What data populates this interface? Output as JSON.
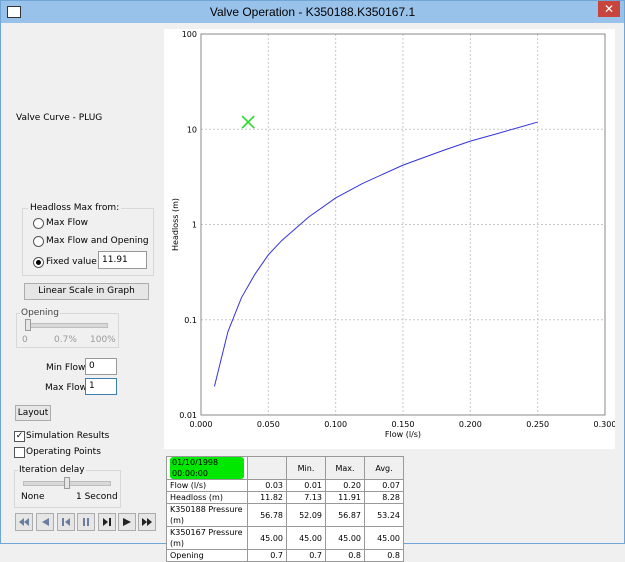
{
  "window": {
    "title": "Valve Operation - K350188.K350167.1",
    "close_symbol": "✕"
  },
  "left": {
    "valve_curve_label": "Valve Curve - PLUG",
    "headloss_group": {
      "title": "Headloss Max from:",
      "options": [
        "Max Flow",
        "Max Flow and Opening",
        "Fixed value"
      ],
      "selected": "Fixed value",
      "fixed_value": "11.91"
    },
    "linear_scale_button": "Linear Scale in Graph",
    "opening_group": {
      "title": "Opening",
      "ticks": [
        "0",
        "0.7%",
        "100%"
      ]
    },
    "min_flow": {
      "label": "Min Flow",
      "value": "0"
    },
    "max_flow": {
      "label": "Max Flow",
      "value": "1"
    },
    "layout_button": "Layout",
    "simulation_results": {
      "label": "Simulation Results",
      "checked": true
    },
    "operating_points": {
      "label": "Operating Points",
      "checked": false
    },
    "iteration_group": {
      "title": "Iteration delay",
      "left": "None",
      "right": "1 Second",
      "level": 0.5
    },
    "media_buttons": [
      "first-icon",
      "step-back-icon",
      "prev-icon",
      "pause-icon",
      "next-icon",
      "play-icon",
      "last-icon"
    ]
  },
  "chart_data": {
    "type": "line",
    "xlabel": "Flow (l/s)",
    "ylabel": "Headloss (m)",
    "xlim": [
      0,
      0.3
    ],
    "ylim": [
      0.01,
      100
    ],
    "yscale": "log",
    "x_ticks": [
      "0.000",
      "0.050",
      "0.100",
      "0.150",
      "0.200",
      "0.250",
      "0.300"
    ],
    "y_ticks": [
      "100",
      "10",
      "1",
      "0.1",
      "0.01"
    ],
    "grid": true,
    "series": [
      {
        "color": "#3333dd",
        "x": [
          0.01,
          0.02,
          0.03,
          0.04,
          0.05,
          0.06,
          0.08,
          0.1,
          0.12,
          0.15,
          0.18,
          0.2,
          0.22,
          0.25
        ],
        "y": [
          0.02,
          0.075,
          0.17,
          0.3,
          0.48,
          0.68,
          1.2,
          1.9,
          2.7,
          4.2,
          6.0,
          7.5,
          9.0,
          11.9
        ]
      }
    ],
    "marker": {
      "x": 0.035,
      "y": 11.91,
      "color": "#22dd22",
      "shape": "x"
    }
  },
  "table": {
    "timestamp": "01/10/1998 00:00:00",
    "headers": [
      "",
      "Min.",
      "Max.",
      "Avg."
    ],
    "rows": [
      {
        "label": "Flow (l/s)",
        "values": [
          "0.03",
          "0.01",
          "0.20",
          "0.07"
        ]
      },
      {
        "label": "Headloss (m)",
        "values": [
          "11.82",
          "7.13",
          "11.91",
          "8.28"
        ]
      },
      {
        "label": "K350188 Pressure (m)",
        "values": [
          "56.78",
          "52.09",
          "56.87",
          "53.24"
        ]
      },
      {
        "label": "K350167 Pressure (m)",
        "values": [
          "45.00",
          "45.00",
          "45.00",
          "45.00"
        ]
      },
      {
        "label": "Opening",
        "values": [
          "0.7",
          "0.7",
          "0.8",
          "0.8"
        ]
      }
    ]
  }
}
